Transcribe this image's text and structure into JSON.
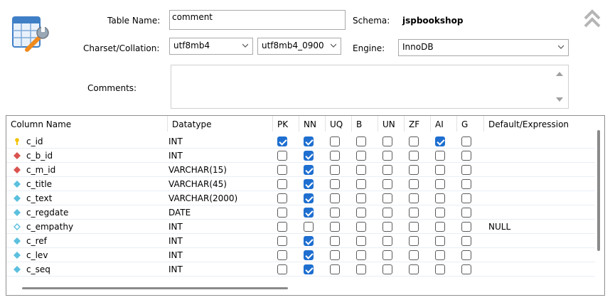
{
  "form": {
    "table_name_label": "Table Name:",
    "table_name_value": "comment",
    "schema_label": "Schema:",
    "schema_value": "jspbookshop",
    "charset_label": "Charset/Collation:",
    "charset_value": "utf8mb4",
    "collation_value": "utf8mb4_0900",
    "engine_label": "Engine:",
    "engine_value": "InnoDB",
    "comments_label": "Comments:",
    "comments_value": ""
  },
  "icons": {
    "table_editor": "table-wrench-icon",
    "collapse": "double-chevron-up-icon",
    "pk": "key-icon",
    "fk": "red-diamond-icon",
    "column": "blue-diamond-icon",
    "nullable_column": "hollow-diamond-icon"
  },
  "colors": {
    "check_on": "#1e6fd0",
    "pk_key": "#f2c200",
    "fk_diamond": "#d9534f",
    "col_diamond": "#5bc0de"
  },
  "grid": {
    "headers": [
      "Column Name",
      "Datatype",
      "PK",
      "NN",
      "UQ",
      "B",
      "UN",
      "ZF",
      "AI",
      "G",
      "Default/Expression"
    ],
    "rows": [
      {
        "name": "c_id",
        "icon": "pk",
        "type": "INT",
        "pk": true,
        "nn": true,
        "uq": false,
        "b": false,
        "un": false,
        "zf": false,
        "ai": true,
        "g": false,
        "def": ""
      },
      {
        "name": "c_b_id",
        "icon": "fk",
        "type": "INT",
        "pk": false,
        "nn": true,
        "uq": false,
        "b": false,
        "un": false,
        "zf": false,
        "ai": false,
        "g": false,
        "def": ""
      },
      {
        "name": "c_m_id",
        "icon": "fk",
        "type": "VARCHAR(15)",
        "pk": false,
        "nn": true,
        "uq": false,
        "b": false,
        "un": false,
        "zf": false,
        "ai": false,
        "g": false,
        "def": ""
      },
      {
        "name": "c_title",
        "icon": "col",
        "type": "VARCHAR(45)",
        "pk": false,
        "nn": true,
        "uq": false,
        "b": false,
        "un": false,
        "zf": false,
        "ai": false,
        "g": false,
        "def": ""
      },
      {
        "name": "c_text",
        "icon": "col",
        "type": "VARCHAR(2000)",
        "pk": false,
        "nn": true,
        "uq": false,
        "b": false,
        "un": false,
        "zf": false,
        "ai": false,
        "g": false,
        "def": ""
      },
      {
        "name": "c_regdate",
        "icon": "col",
        "type": "DATE",
        "pk": false,
        "nn": true,
        "uq": false,
        "b": false,
        "un": false,
        "zf": false,
        "ai": false,
        "g": false,
        "def": ""
      },
      {
        "name": "c_empathy",
        "icon": "null",
        "type": "INT",
        "pk": false,
        "nn": false,
        "uq": false,
        "b": false,
        "un": false,
        "zf": false,
        "ai": false,
        "g": false,
        "def": "NULL"
      },
      {
        "name": "c_ref",
        "icon": "col",
        "type": "INT",
        "pk": false,
        "nn": true,
        "uq": false,
        "b": false,
        "un": false,
        "zf": false,
        "ai": false,
        "g": false,
        "def": ""
      },
      {
        "name": "c_lev",
        "icon": "col",
        "type": "INT",
        "pk": false,
        "nn": true,
        "uq": false,
        "b": false,
        "un": false,
        "zf": false,
        "ai": false,
        "g": false,
        "def": ""
      },
      {
        "name": "c_seq",
        "icon": "col",
        "type": "INT",
        "pk": false,
        "nn": true,
        "uq": false,
        "b": false,
        "un": false,
        "zf": false,
        "ai": false,
        "g": false,
        "def": ""
      }
    ]
  }
}
